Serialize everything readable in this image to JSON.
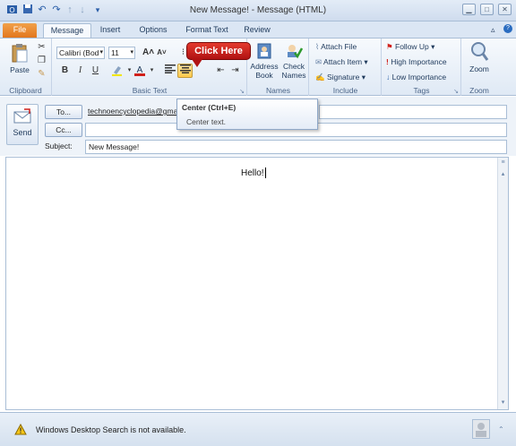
{
  "window": {
    "title": "New Message! - Message (HTML)",
    "qat_icons": [
      "outlook-icon",
      "save-icon",
      "undo-icon",
      "redo-icon",
      "up-arrow-icon",
      "down-arrow-icon",
      "customize-icon"
    ]
  },
  "tabs": [
    "File",
    "Message",
    "Insert",
    "Options",
    "Format Text",
    "Review"
  ],
  "ribbon": {
    "clipboard": {
      "label": "Clipboard",
      "paste": "Paste"
    },
    "basic_text": {
      "label": "Basic Text",
      "font": "Calibri (Bod",
      "size": "11",
      "bold": "B",
      "italic": "I",
      "underline": "U",
      "grow": "A˄",
      "shrink": "A˅"
    },
    "names": {
      "label": "Names",
      "address_book": [
        "Address",
        "Book"
      ],
      "check_names": [
        "Check",
        "Names"
      ]
    },
    "include": {
      "label": "Include",
      "attach_file": "Attach File",
      "attach_item": "Attach Item ▾",
      "signature": "Signature ▾"
    },
    "tags": {
      "label": "Tags",
      "follow_up": "Follow Up ▾",
      "high": "High Importance",
      "low": "Low Importance"
    },
    "zoom": {
      "label": "Zoom",
      "button": "Zoom"
    }
  },
  "callout": "Click Here",
  "tooltip": {
    "title": "Center (Ctrl+E)",
    "desc": "Center text."
  },
  "compose": {
    "send": "Send",
    "to_label": "To...",
    "cc_label": "Cc...",
    "subject_label": "Subject:",
    "to_value": "technoencyclopedia@gmail.c",
    "subject_value": "New Message!",
    "body": "Hello!"
  },
  "status": {
    "message": "Windows Desktop Search is not available."
  },
  "colors": {
    "accent_file": "#e2761d",
    "callout": "#c0201a",
    "ribbon_bg": "#dfe9f5"
  }
}
